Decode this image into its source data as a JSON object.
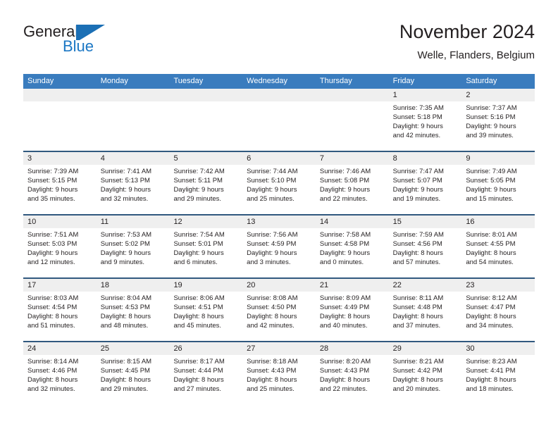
{
  "brand": {
    "name_part1": "General",
    "name_part2": "Blue",
    "mark": "blue-flag-triangle"
  },
  "header": {
    "title": "November 2024",
    "subtitle": "Welle, Flanders, Belgium"
  },
  "colors": {
    "header_blue": "#3a7cbe",
    "week_separator": "#31597f",
    "daynum_band": "#efefef",
    "brand_blue": "#1b77c4",
    "text": "#231f20"
  },
  "weekdays": [
    "Sunday",
    "Monday",
    "Tuesday",
    "Wednesday",
    "Thursday",
    "Friday",
    "Saturday"
  ],
  "weeks": [
    [
      {
        "day": "",
        "lines": []
      },
      {
        "day": "",
        "lines": []
      },
      {
        "day": "",
        "lines": []
      },
      {
        "day": "",
        "lines": []
      },
      {
        "day": "",
        "lines": []
      },
      {
        "day": "1",
        "lines": [
          "Sunrise: 7:35 AM",
          "Sunset: 5:18 PM",
          "Daylight: 9 hours",
          "and 42 minutes."
        ]
      },
      {
        "day": "2",
        "lines": [
          "Sunrise: 7:37 AM",
          "Sunset: 5:16 PM",
          "Daylight: 9 hours",
          "and 39 minutes."
        ]
      }
    ],
    [
      {
        "day": "3",
        "lines": [
          "Sunrise: 7:39 AM",
          "Sunset: 5:15 PM",
          "Daylight: 9 hours",
          "and 35 minutes."
        ]
      },
      {
        "day": "4",
        "lines": [
          "Sunrise: 7:41 AM",
          "Sunset: 5:13 PM",
          "Daylight: 9 hours",
          "and 32 minutes."
        ]
      },
      {
        "day": "5",
        "lines": [
          "Sunrise: 7:42 AM",
          "Sunset: 5:11 PM",
          "Daylight: 9 hours",
          "and 29 minutes."
        ]
      },
      {
        "day": "6",
        "lines": [
          "Sunrise: 7:44 AM",
          "Sunset: 5:10 PM",
          "Daylight: 9 hours",
          "and 25 minutes."
        ]
      },
      {
        "day": "7",
        "lines": [
          "Sunrise: 7:46 AM",
          "Sunset: 5:08 PM",
          "Daylight: 9 hours",
          "and 22 minutes."
        ]
      },
      {
        "day": "8",
        "lines": [
          "Sunrise: 7:47 AM",
          "Sunset: 5:07 PM",
          "Daylight: 9 hours",
          "and 19 minutes."
        ]
      },
      {
        "day": "9",
        "lines": [
          "Sunrise: 7:49 AM",
          "Sunset: 5:05 PM",
          "Daylight: 9 hours",
          "and 15 minutes."
        ]
      }
    ],
    [
      {
        "day": "10",
        "lines": [
          "Sunrise: 7:51 AM",
          "Sunset: 5:03 PM",
          "Daylight: 9 hours",
          "and 12 minutes."
        ]
      },
      {
        "day": "11",
        "lines": [
          "Sunrise: 7:53 AM",
          "Sunset: 5:02 PM",
          "Daylight: 9 hours",
          "and 9 minutes."
        ]
      },
      {
        "day": "12",
        "lines": [
          "Sunrise: 7:54 AM",
          "Sunset: 5:01 PM",
          "Daylight: 9 hours",
          "and 6 minutes."
        ]
      },
      {
        "day": "13",
        "lines": [
          "Sunrise: 7:56 AM",
          "Sunset: 4:59 PM",
          "Daylight: 9 hours",
          "and 3 minutes."
        ]
      },
      {
        "day": "14",
        "lines": [
          "Sunrise: 7:58 AM",
          "Sunset: 4:58 PM",
          "Daylight: 9 hours",
          "and 0 minutes."
        ]
      },
      {
        "day": "15",
        "lines": [
          "Sunrise: 7:59 AM",
          "Sunset: 4:56 PM",
          "Daylight: 8 hours",
          "and 57 minutes."
        ]
      },
      {
        "day": "16",
        "lines": [
          "Sunrise: 8:01 AM",
          "Sunset: 4:55 PM",
          "Daylight: 8 hours",
          "and 54 minutes."
        ]
      }
    ],
    [
      {
        "day": "17",
        "lines": [
          "Sunrise: 8:03 AM",
          "Sunset: 4:54 PM",
          "Daylight: 8 hours",
          "and 51 minutes."
        ]
      },
      {
        "day": "18",
        "lines": [
          "Sunrise: 8:04 AM",
          "Sunset: 4:53 PM",
          "Daylight: 8 hours",
          "and 48 minutes."
        ]
      },
      {
        "day": "19",
        "lines": [
          "Sunrise: 8:06 AM",
          "Sunset: 4:51 PM",
          "Daylight: 8 hours",
          "and 45 minutes."
        ]
      },
      {
        "day": "20",
        "lines": [
          "Sunrise: 8:08 AM",
          "Sunset: 4:50 PM",
          "Daylight: 8 hours",
          "and 42 minutes."
        ]
      },
      {
        "day": "21",
        "lines": [
          "Sunrise: 8:09 AM",
          "Sunset: 4:49 PM",
          "Daylight: 8 hours",
          "and 40 minutes."
        ]
      },
      {
        "day": "22",
        "lines": [
          "Sunrise: 8:11 AM",
          "Sunset: 4:48 PM",
          "Daylight: 8 hours",
          "and 37 minutes."
        ]
      },
      {
        "day": "23",
        "lines": [
          "Sunrise: 8:12 AM",
          "Sunset: 4:47 PM",
          "Daylight: 8 hours",
          "and 34 minutes."
        ]
      }
    ],
    [
      {
        "day": "24",
        "lines": [
          "Sunrise: 8:14 AM",
          "Sunset: 4:46 PM",
          "Daylight: 8 hours",
          "and 32 minutes."
        ]
      },
      {
        "day": "25",
        "lines": [
          "Sunrise: 8:15 AM",
          "Sunset: 4:45 PM",
          "Daylight: 8 hours",
          "and 29 minutes."
        ]
      },
      {
        "day": "26",
        "lines": [
          "Sunrise: 8:17 AM",
          "Sunset: 4:44 PM",
          "Daylight: 8 hours",
          "and 27 minutes."
        ]
      },
      {
        "day": "27",
        "lines": [
          "Sunrise: 8:18 AM",
          "Sunset: 4:43 PM",
          "Daylight: 8 hours",
          "and 25 minutes."
        ]
      },
      {
        "day": "28",
        "lines": [
          "Sunrise: 8:20 AM",
          "Sunset: 4:43 PM",
          "Daylight: 8 hours",
          "and 22 minutes."
        ]
      },
      {
        "day": "29",
        "lines": [
          "Sunrise: 8:21 AM",
          "Sunset: 4:42 PM",
          "Daylight: 8 hours",
          "and 20 minutes."
        ]
      },
      {
        "day": "30",
        "lines": [
          "Sunrise: 8:23 AM",
          "Sunset: 4:41 PM",
          "Daylight: 8 hours",
          "and 18 minutes."
        ]
      }
    ]
  ]
}
